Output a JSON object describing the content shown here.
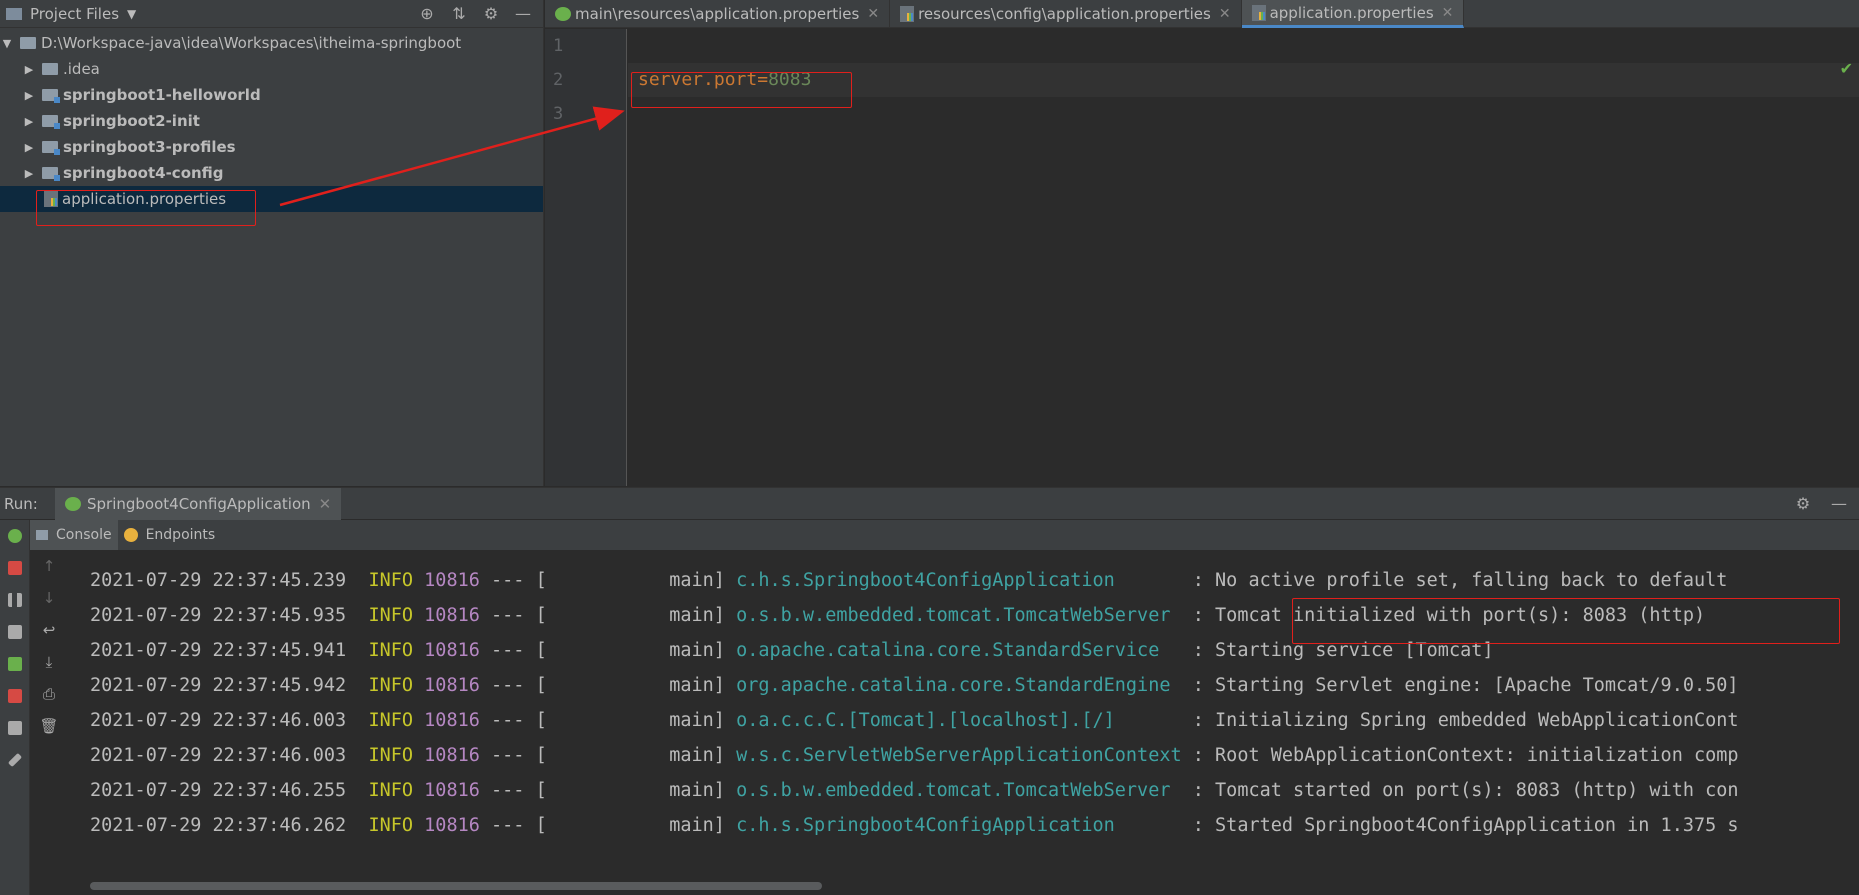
{
  "project_panel": {
    "title": "Project Files",
    "root_path": "D:\\Workspace-java\\idea\\Workspaces\\itheima-springboot",
    "items": [
      {
        "label": ".idea",
        "module": false
      },
      {
        "label": "springboot1-helloworld",
        "module": true
      },
      {
        "label": "springboot2-init",
        "module": true
      },
      {
        "label": "springboot3-profiles",
        "module": true
      },
      {
        "label": "springboot4-config",
        "module": true
      }
    ],
    "selected_file": "application.properties"
  },
  "editor": {
    "tabs": [
      {
        "label": "main\\resources\\application.properties"
      },
      {
        "label": "resources\\config\\application.properties"
      },
      {
        "label": "application.properties"
      }
    ],
    "line_numbers": [
      "1",
      "2",
      "3"
    ],
    "code": {
      "key": "server.port",
      "eq": "=",
      "value": "8083"
    }
  },
  "run_panel": {
    "label": "Run:",
    "config_name": "Springboot4ConfigApplication",
    "console_tab": "Console",
    "endpoints_tab": "Endpoints"
  },
  "log_lines": [
    {
      "ts": "2021-07-29 22:37:45.239",
      "level": "INFO",
      "pid": "10816",
      "sep": "--- [",
      "thread": "main]",
      "logger": "c.h.s.Springboot4ConfigApplication      ",
      "msg": ": No active profile set, falling back to default"
    },
    {
      "ts": "2021-07-29 22:37:45.935",
      "level": "INFO",
      "pid": "10816",
      "sep": "--- [",
      "thread": "main]",
      "logger": "o.s.b.w.embedded.tomcat.TomcatWebServer ",
      "msg": ": Tomcat initialized with port(s): 8083 (http)"
    },
    {
      "ts": "2021-07-29 22:37:45.941",
      "level": "INFO",
      "pid": "10816",
      "sep": "--- [",
      "thread": "main]",
      "logger": "o.apache.catalina.core.StandardService  ",
      "msg": ": Starting service [Tomcat]"
    },
    {
      "ts": "2021-07-29 22:37:45.942",
      "level": "INFO",
      "pid": "10816",
      "sep": "--- [",
      "thread": "main]",
      "logger": "org.apache.catalina.core.StandardEngine ",
      "msg": ": Starting Servlet engine: [Apache Tomcat/9.0.50]"
    },
    {
      "ts": "2021-07-29 22:37:46.003",
      "level": "INFO",
      "pid": "10816",
      "sep": "--- [",
      "thread": "main]",
      "logger": "o.a.c.c.C.[Tomcat].[localhost].[/]      ",
      "msg": ": Initializing Spring embedded WebApplicationCont"
    },
    {
      "ts": "2021-07-29 22:37:46.003",
      "level": "INFO",
      "pid": "10816",
      "sep": "--- [",
      "thread": "main]",
      "logger": "w.s.c.ServletWebServerApplicationContext",
      "msg": ": Root WebApplicationContext: initialization comp"
    },
    {
      "ts": "2021-07-29 22:37:46.255",
      "level": "INFO",
      "pid": "10816",
      "sep": "--- [",
      "thread": "main]",
      "logger": "o.s.b.w.embedded.tomcat.TomcatWebServer ",
      "msg": ": Tomcat started on port(s): 8083 (http) with con"
    },
    {
      "ts": "2021-07-29 22:37:46.262",
      "level": "INFO",
      "pid": "10816",
      "sep": "--- [",
      "thread": "main]",
      "logger": "c.h.s.Springboot4ConfigApplication      ",
      "msg": ": Started Springboot4ConfigApplication in 1.375 s"
    }
  ],
  "colors": {
    "annotation": "#e0201c",
    "key": "#cc7832",
    "value": "#6a8759",
    "info": "#c7c72a",
    "pid": "#b587c2",
    "logger": "#3fa3a3"
  }
}
